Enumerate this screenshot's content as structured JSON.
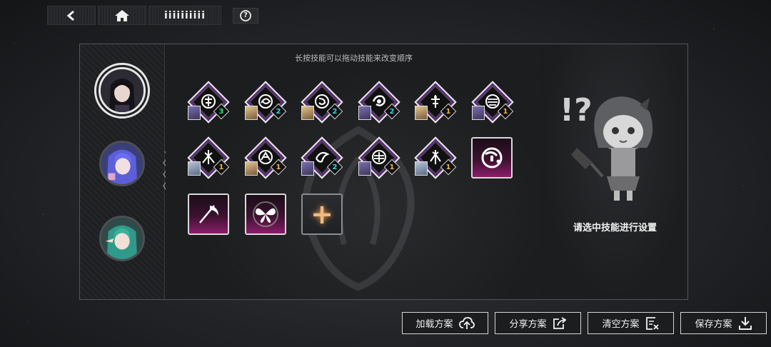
{
  "topbar": {
    "back_icon": "back-arrow-icon",
    "home_icon": "home-icon",
    "title": "iiiiiiiiii",
    "help_label": "?"
  },
  "panel": {
    "hint": "长按技能可以拖动技能来改变顺序",
    "characters": [
      {
        "name": "character-1",
        "selected": true
      },
      {
        "name": "character-2",
        "selected": false
      },
      {
        "name": "character-3",
        "selected": false
      }
    ],
    "skills": [
      {
        "level": "3",
        "level_color": "#37e07a"
      },
      {
        "level": "2",
        "level_color": "#37d4e0"
      },
      {
        "level": "2",
        "level_color": "#37d4e0"
      },
      {
        "level": "2",
        "level_color": "#37d4e0"
      },
      {
        "level": "1",
        "level_color": "#f1b24a"
      },
      {
        "level": "1",
        "level_color": "#f1b24a"
      },
      {
        "level": "1",
        "level_color": "#f1b24a"
      },
      {
        "level": "1",
        "level_color": "#f1b24a"
      },
      {
        "level": "2",
        "level_color": "#37d4e0"
      },
      {
        "level": "1",
        "level_color": "#f1b24a"
      },
      {
        "level": "1",
        "level_color": "#f1b24a"
      }
    ],
    "cards": [
      {
        "icon": "spiral-glyph-icon"
      },
      {
        "icon": "scythe-icon"
      },
      {
        "icon": "butterfly-icon"
      }
    ],
    "add_label": "+",
    "info_text": "请选中技能进行设置"
  },
  "actions": {
    "load": "加载方案",
    "share": "分享方案",
    "clear": "清空方案",
    "save": "保存方案"
  }
}
